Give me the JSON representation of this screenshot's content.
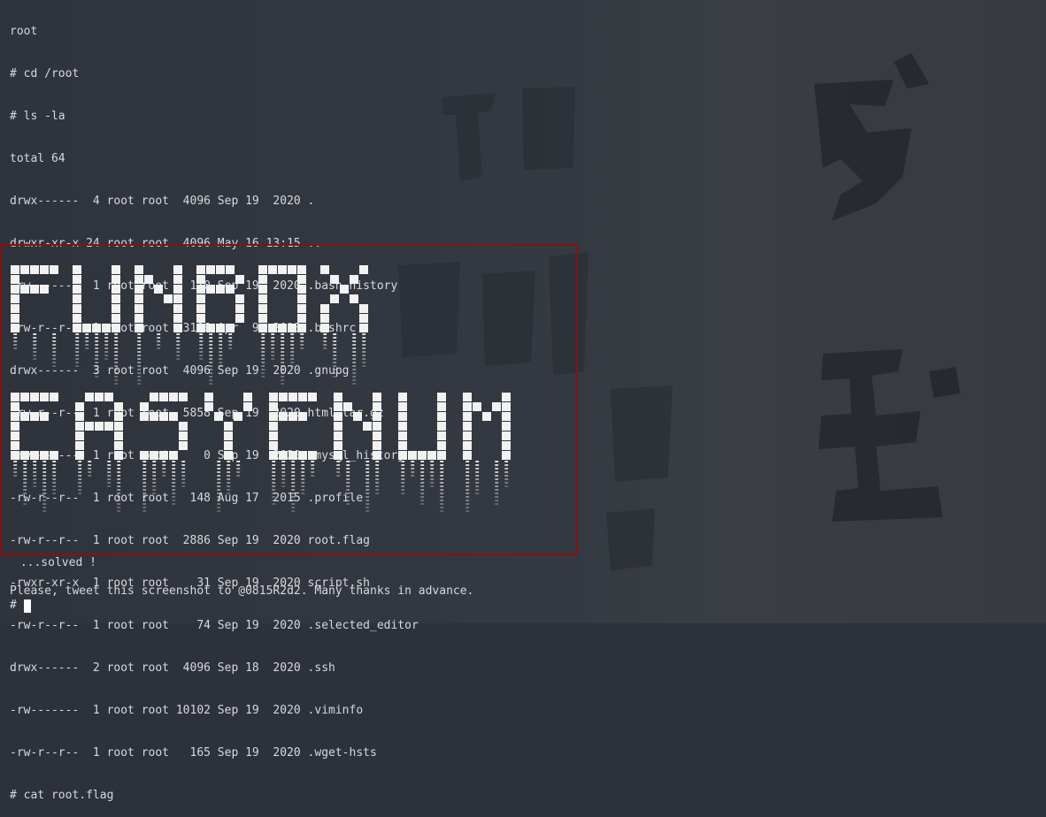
{
  "terminal": {
    "lines": [
      "root",
      "# cd /root",
      "# ls -la",
      "total 64",
      "drwx------  4 root root  4096 Sep 19  2020 .",
      "drwxr-xr-x 24 root root  4096 May 16 13:15 ..",
      "-rw-------  1 root root   110 Sep 19  2020 .bash_history",
      "-rw-r--r--  1 root root  3106 Apr  9  2018 .bashrc",
      "drwx------  3 root root  4096 Sep 19  2020 .gnupg",
      "-rw-r--r--  1 root root  5858 Sep 19  2020 html.tar.gz",
      "-rw-------  1 root root     0 Sep 19  2020 .mysql_history",
      "-rw-r--r--  1 root root   148 Aug 17  2015 .profile",
      "-rw-r--r--  1 root root  2886 Sep 19  2020 root.flag",
      "-rwxr-xr-x  1 root root    31 Sep 19  2020 script.sh",
      "-rw-r--r--  1 root root    74 Sep 19  2020 .selected_editor",
      "drwx------  2 root root  4096 Sep 18  2020 .ssh",
      "-rw-------  1 root root 10102 Sep 19  2020 .viminfo",
      "-rw-r--r--  1 root root   165 Sep 19  2020 .wget-hsts",
      "# cat root.flag"
    ],
    "banner_lines": [
      "FUNBOX",
      "EASYENUM"
    ],
    "solved": " ...solved !",
    "tweet": "Please, tweet this screenshot to @0815R2d2. Many thanks in advance.",
    "prompt": "#"
  },
  "colors": {
    "background": "#2c313a",
    "text": "#d7d9de",
    "highlight_border": "#8d0f0f",
    "banner_text": "#f2f2f2"
  },
  "icons": {
    "cursor": "block-cursor"
  }
}
